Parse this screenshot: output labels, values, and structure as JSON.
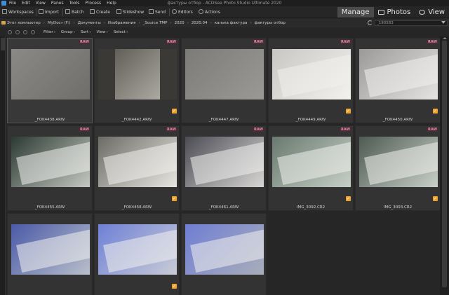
{
  "window": {
    "title": "фактуры отбор - ACDSee Photo Studio Ultimate 2020"
  },
  "menu": [
    "File",
    "Edit",
    "View",
    "Panes",
    "Tools",
    "Process",
    "Help"
  ],
  "toolbar": {
    "workspaces": "Workspaces",
    "import": "Import",
    "batch": "Batch",
    "create": "Create",
    "slideshow": "Slideshow",
    "send": "Send",
    "editors": "Editors",
    "actions": "Actions"
  },
  "modes": {
    "manage": "Manage",
    "photos": "Photos",
    "view": "View"
  },
  "path": [
    "Этот компьютер",
    "MyDoc» (F:)",
    "Документы",
    "Изображения",
    "_Source TMP",
    "2020",
    "2020.04",
    "калька фактура",
    "фактуры отбор"
  ],
  "search": {
    "value": "_190583"
  },
  "filters": {
    "filter": "Filter",
    "group": "Group",
    "sort": "Sort",
    "view": "View",
    "select": "Select"
  },
  "badge": "RAW",
  "items": [
    {
      "name": "_FOK4438.ARW",
      "raw": true,
      "checked": false,
      "tone": "stone1"
    },
    {
      "name": "_FOK4442.ARW",
      "raw": true,
      "checked": true,
      "tone": "window"
    },
    {
      "name": "_FOK4447.ARW",
      "raw": true,
      "checked": false,
      "tone": "stone2"
    },
    {
      "name": "_FOK4449.ARW",
      "raw": true,
      "checked": true,
      "tone": "paper1"
    },
    {
      "name": "_FOK4450.ARW",
      "raw": true,
      "checked": true,
      "tone": "paper2"
    },
    {
      "name": "_FOK4455.ARW",
      "raw": true,
      "checked": false,
      "tone": "green1"
    },
    {
      "name": "_FOK4458.ARW",
      "raw": true,
      "checked": true,
      "tone": "paper3"
    },
    {
      "name": "_FOK4461.ARW",
      "raw": true,
      "checked": false,
      "tone": "paper4"
    },
    {
      "name": "IMG_3092.CR2",
      "raw": true,
      "checked": true,
      "tone": "green2"
    },
    {
      "name": "IMG_3093.CR2",
      "raw": true,
      "checked": true,
      "tone": "green3"
    },
    {
      "name": "",
      "raw": false,
      "checked": false,
      "tone": "blue1"
    },
    {
      "name": "",
      "raw": false,
      "checked": true,
      "tone": "blue2"
    },
    {
      "name": "",
      "raw": false,
      "checked": false,
      "tone": "blue3"
    }
  ],
  "colors": {
    "accent": "#f0a430",
    "raw_badge": "#e08aa0",
    "active_mode": "#4a4a4a"
  }
}
